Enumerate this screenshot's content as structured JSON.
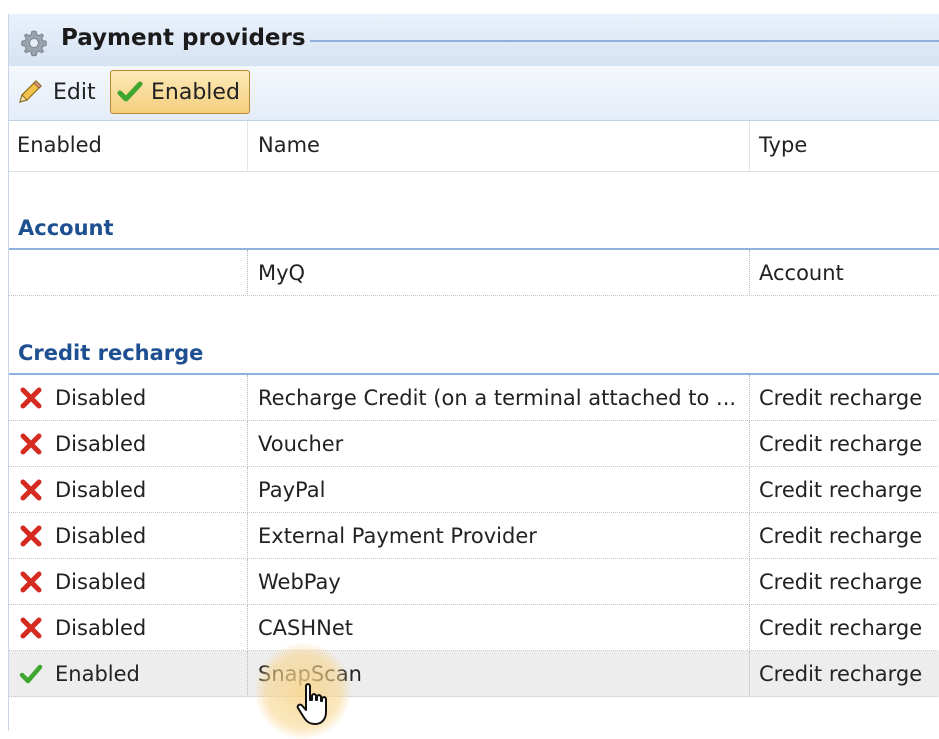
{
  "window": {
    "title": "Payment providers",
    "title_icon": "gear-icon"
  },
  "toolbar": {
    "edit_label": "Edit",
    "edit_icon": "pencil-icon",
    "enabled_label": "Enabled",
    "enabled_icon": "checkmark-icon"
  },
  "columns": [
    "Enabled",
    "Name",
    "Type"
  ],
  "groups": [
    {
      "label": "Account",
      "rows": [
        {
          "enabled": "",
          "name": "MyQ",
          "type": "Account"
        }
      ]
    },
    {
      "label": "Credit recharge",
      "rows": [
        {
          "enabled": "Disabled",
          "status_icon": "red-x-icon",
          "name": "Recharge Credit (on a terminal attached to ...",
          "type": "Credit recharge"
        },
        {
          "enabled": "Disabled",
          "status_icon": "red-x-icon",
          "name": "Voucher",
          "type": "Credit recharge"
        },
        {
          "enabled": "Disabled",
          "status_icon": "red-x-icon",
          "name": "PayPal",
          "type": "Credit recharge"
        },
        {
          "enabled": "Disabled",
          "status_icon": "red-x-icon",
          "name": "External Payment Provider",
          "type": "Credit recharge"
        },
        {
          "enabled": "Disabled",
          "status_icon": "red-x-icon",
          "name": "WebPay",
          "type": "Credit recharge"
        },
        {
          "enabled": "Disabled",
          "status_icon": "red-x-icon",
          "name": "CASHNet",
          "type": "Credit recharge"
        },
        {
          "enabled": "Enabled",
          "status_icon": "green-check-icon",
          "name": "SnapScan",
          "type": "Credit recharge",
          "selected": true
        }
      ]
    }
  ],
  "colors": {
    "group_header_text": "#1d4f91",
    "group_line": "#8fb2dc",
    "selected_row": "#ededed",
    "enabled_button_bg": "#f4cf7f",
    "disabled_icon": "#d42a1f",
    "enabled_icon": "#3fa62f"
  }
}
